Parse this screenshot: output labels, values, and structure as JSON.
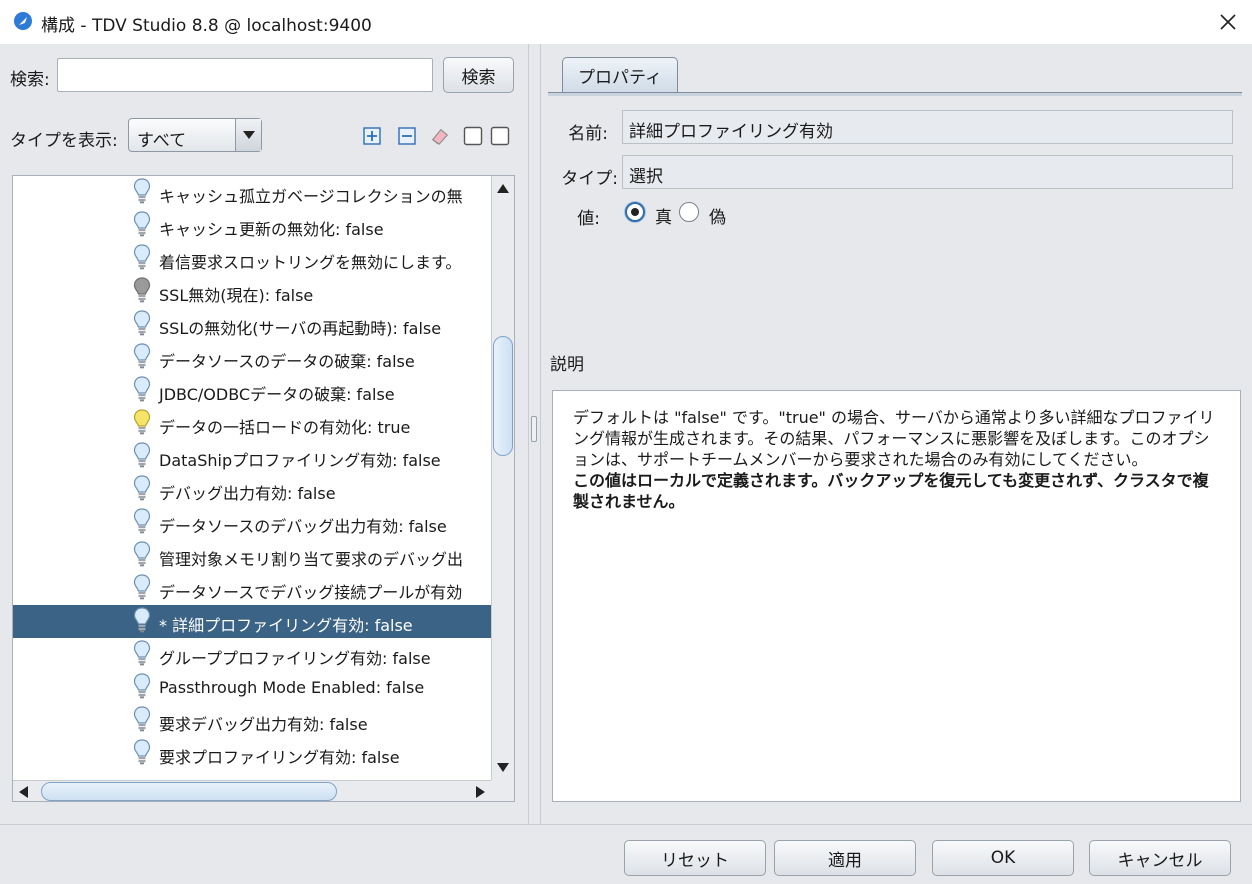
{
  "window": {
    "title": "構成 - TDV Studio 8.8 @ localhost:9400"
  },
  "search": {
    "label": "検索:",
    "value": "",
    "placeholder": "",
    "button": "検索"
  },
  "filter": {
    "label": "タイプを表示:",
    "selected": "すべて"
  },
  "toolbar": {
    "icons": [
      "expand-all-icon",
      "collapse-all-icon",
      "eraser-icon",
      "checkbox-icon",
      "checkbox-icon"
    ]
  },
  "tree": {
    "items": [
      {
        "label": "キャッシュ孤立ガベージコレクションの無",
        "bulb": "blue"
      },
      {
        "label": "キャッシュ更新の無効化: false",
        "bulb": "blue"
      },
      {
        "label": "着信要求スロットリングを無効にします。",
        "bulb": "blue"
      },
      {
        "label": "SSL無効(現在): false",
        "bulb": "gray"
      },
      {
        "label": "SSLの無効化(サーバの再起動時): false",
        "bulb": "blue"
      },
      {
        "label": "データソースのデータの破棄: false",
        "bulb": "blue"
      },
      {
        "label": "JDBC/ODBCデータの破棄: false",
        "bulb": "blue"
      },
      {
        "label": "データの一括ロードの有効化: true",
        "bulb": "yellow"
      },
      {
        "label": "DataShipプロファイリング有効: false",
        "bulb": "blue"
      },
      {
        "label": "デバッグ出力有効: false",
        "bulb": "blue"
      },
      {
        "label": "データソースのデバッグ出力有効: false",
        "bulb": "blue"
      },
      {
        "label": "管理対象メモリ割り当て要求のデバッグ出",
        "bulb": "blue"
      },
      {
        "label": "データソースでデバッグ接続プールが有効",
        "bulb": "blue"
      },
      {
        "label": "* 詳細プロファイリング有効: false",
        "bulb": "blue",
        "selected": true
      },
      {
        "label": "グループプロファイリング有効: false",
        "bulb": "blue"
      },
      {
        "label": "Passthrough Mode Enabled: false",
        "bulb": "blue"
      },
      {
        "label": "要求デバッグ出力有効: false",
        "bulb": "blue"
      },
      {
        "label": "要求プロファイリング有効: false",
        "bulb": "blue"
      }
    ]
  },
  "properties": {
    "tab": "プロパティ",
    "name_label": "名前:",
    "name_value": "詳細プロファイリング有効",
    "type_label": "タイプ:",
    "type_value": "選択",
    "value_label": "値:",
    "option_true": "真",
    "option_false": "偽",
    "selected_option": "true",
    "description_label": "説明",
    "description_text": "デフォルトは \"false\" です。\"true\" の場合、サーバから通常より多い詳細なプロファイリング情報が生成されます。その結果、パフォーマンスに悪影響を及ぼします。このオプションは、サポートチームメンバーから要求された場合のみ有効にしてください。",
    "description_bold": "この値はローカルで定義されます。バックアップを復元しても変更されず、クラスタで複製されません。"
  },
  "footer": {
    "reset": "リセット",
    "apply": "適用",
    "ok": "OK",
    "cancel": "キャンセル"
  },
  "colors": {
    "selection": "#3b6385",
    "dialog_bg": "#e6e8ec"
  }
}
